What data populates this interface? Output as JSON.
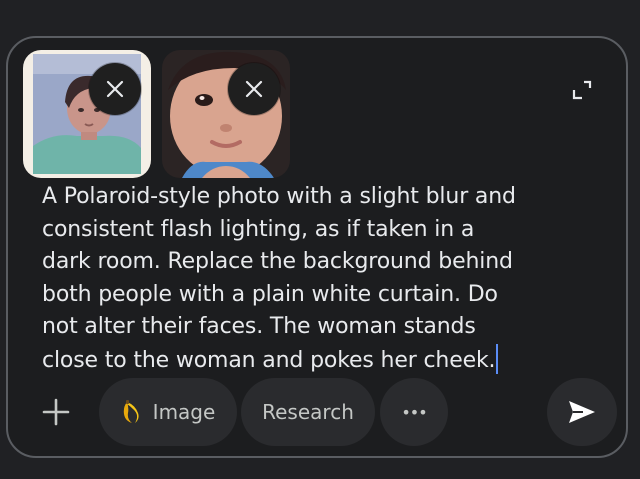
{
  "attachments": [
    {
      "name": "photo-of-child-girl",
      "remove_icon": "close-icon"
    },
    {
      "name": "photo-of-child-face",
      "remove_icon": "close-icon"
    }
  ],
  "expand_icon": "expand-icon",
  "prompt_lines": [
    "A Polaroid-style photo with a slight blur and",
    "consistent flash lighting, as if taken in a",
    "dark room. Replace the background behind",
    "both people with a plain white curtain. Do",
    "not alter their faces. The woman stands",
    "close to the woman and pokes her cheek."
  ],
  "toolbar": {
    "add_icon": "plus-icon",
    "image_label": "Image",
    "image_icon": "banana-icon",
    "research_label": "Research",
    "more_label": "•••",
    "send_icon": "send-icon"
  },
  "colors": {
    "background": "#202124",
    "composer": "#1c1d1f",
    "pill": "#2a2b2e",
    "text": "#e8eaed",
    "caret": "#5b8df6"
  }
}
